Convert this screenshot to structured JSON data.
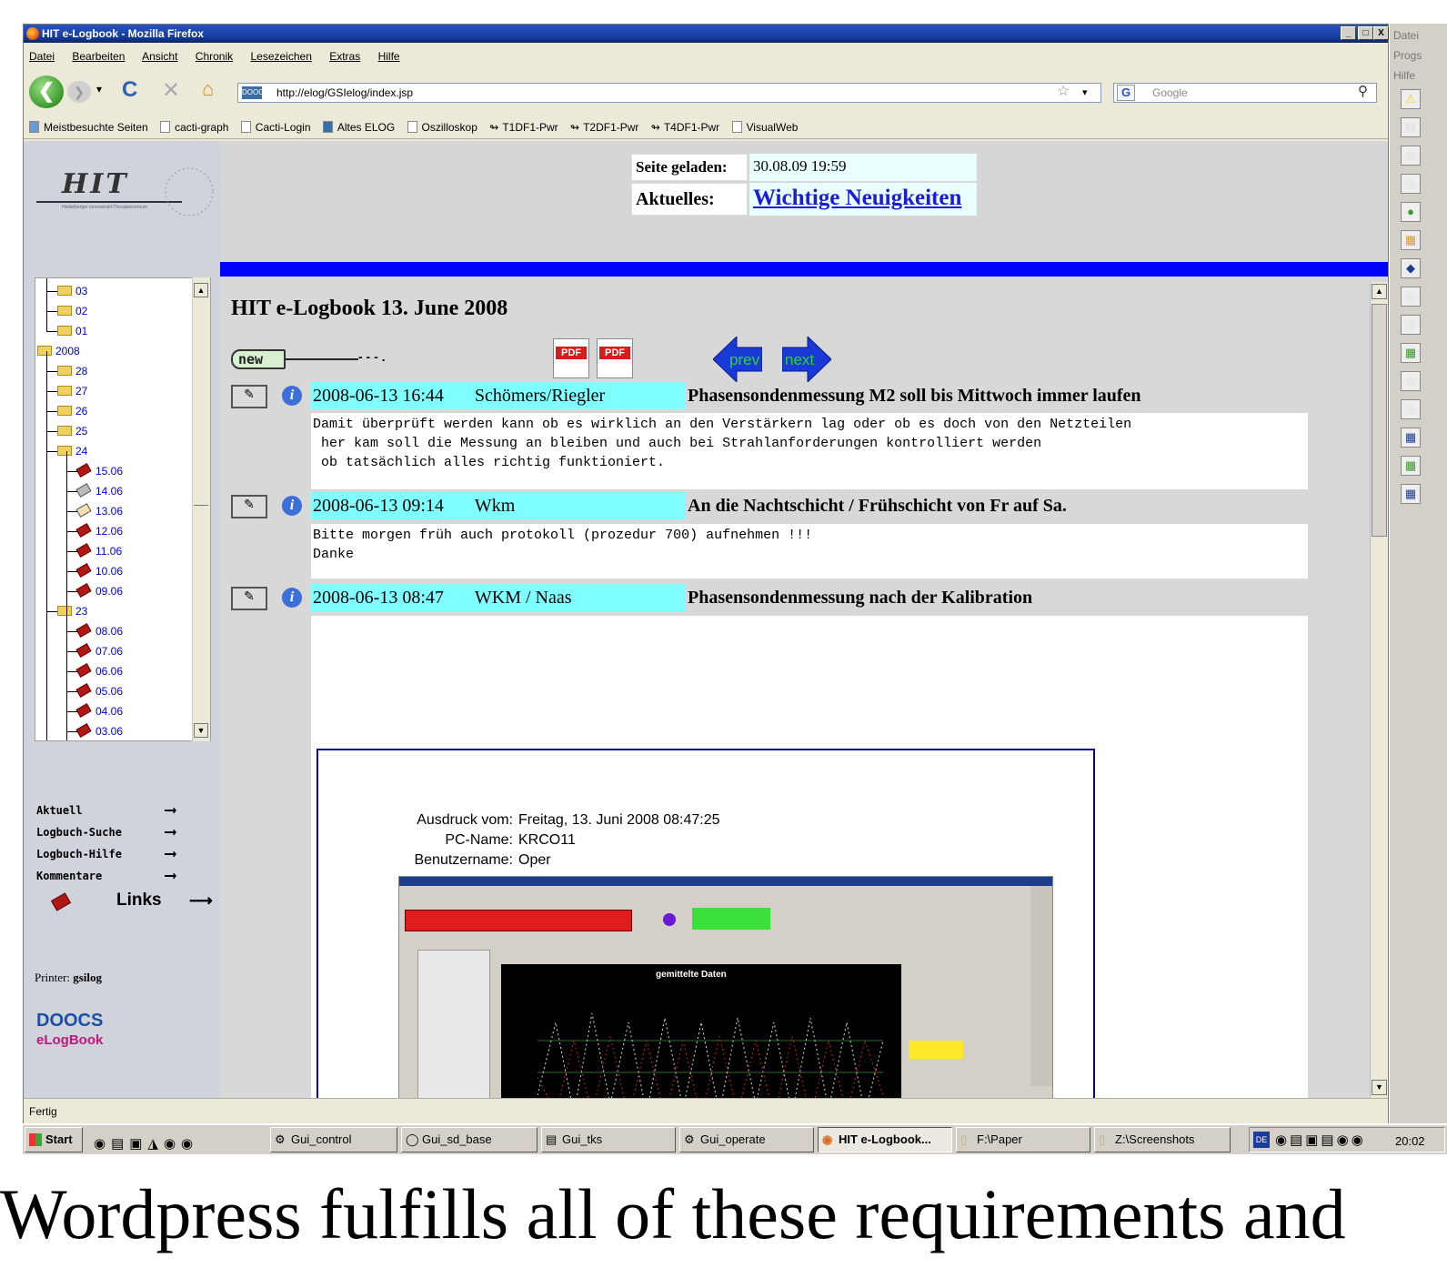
{
  "window": {
    "title": "HIT e-Logbook - Mozilla Firefox",
    "btn_min": "_",
    "btn_max": "□",
    "btn_close": "X"
  },
  "menu": [
    "Datei",
    "Bearbeiten",
    "Ansicht",
    "Chronik",
    "Lesezeichen",
    "Extras",
    "Hilfe"
  ],
  "nav": {
    "url": "http://elog/GSIelog/index.jsp",
    "search_placeholder": "Google",
    "favicon_text": "DOOCS"
  },
  "bookmarks": [
    "Meistbesuchte Seiten",
    "cacti-graph",
    "Cacti-Login",
    "Altes ELOG",
    "Oszilloskop",
    "T1DF1-Pwr",
    "T2DF1-Pwr",
    "T4DF1-Pwr",
    "VisualWeb"
  ],
  "logo": {
    "text": "HIT",
    "subtext": "Heidelberger Ionenstrahl-Therapiezentrum"
  },
  "header": {
    "loaded_label": "Seite geladen:",
    "loaded_value": "30.08.09 19:59",
    "news_label": "Aktuelles:",
    "news_link": "Wichtige Neuigkeiten"
  },
  "tree": [
    {
      "label": "03",
      "type": "folder",
      "level": 1
    },
    {
      "label": "02",
      "type": "folder",
      "level": 1
    },
    {
      "label": "01",
      "type": "folder",
      "level": 1
    },
    {
      "label": "2008",
      "type": "folder-open",
      "level": 0
    },
    {
      "label": "28",
      "type": "folder",
      "level": 1
    },
    {
      "label": "27",
      "type": "folder",
      "level": 1
    },
    {
      "label": "26",
      "type": "folder",
      "level": 1
    },
    {
      "label": "25",
      "type": "folder",
      "level": 1
    },
    {
      "label": "24",
      "type": "folder-open",
      "level": 1
    },
    {
      "label": "15.06",
      "type": "book",
      "level": 2
    },
    {
      "label": "14.06",
      "type": "book-grey",
      "level": 2
    },
    {
      "label": "13.06",
      "type": "book-open",
      "level": 2
    },
    {
      "label": "12.06",
      "type": "book",
      "level": 2
    },
    {
      "label": "11.06",
      "type": "book",
      "level": 2
    },
    {
      "label": "10.06",
      "type": "book",
      "level": 2
    },
    {
      "label": "09.06",
      "type": "book",
      "level": 2
    },
    {
      "label": "23",
      "type": "folder-open",
      "level": 1
    },
    {
      "label": "08.06",
      "type": "book",
      "level": 2
    },
    {
      "label": "07.06",
      "type": "book",
      "level": 2
    },
    {
      "label": "06.06",
      "type": "book",
      "level": 2
    },
    {
      "label": "05.06",
      "type": "book",
      "level": 2
    },
    {
      "label": "04.06",
      "type": "book",
      "level": 2
    },
    {
      "label": "03.06",
      "type": "book",
      "level": 2
    }
  ],
  "sidelinks": [
    "Aktuell",
    "Logbuch-Suche",
    "Logbuch-Hilfe",
    "Kommentare",
    "Links"
  ],
  "printer": {
    "label": "Printer:",
    "value": "gsilog"
  },
  "doocs": {
    "line1": "DOOCS",
    "line2": "eLogBook"
  },
  "page_title": "HIT e-Logbook 13. June 2008",
  "toolbar": {
    "new_label": "new",
    "pdf1": "PDF",
    "pdf2": "PDF",
    "prev": "prev",
    "next": "next"
  },
  "entries": [
    {
      "datetime": "2008-06-13 16:44",
      "author": "Schömers/Riegler",
      "subject": "Phasensondenmessung M2 soll bis Mittwoch immer laufen",
      "body": "Damit überprüft werden kann ob es wirklich an den Verstärkern lag oder ob es doch von den Netzteilen\n her kam soll die Messung an bleiben und auch bei Strahlanforderungen kontrolliert werden\n ob tatsächlich alles richtig funktioniert."
    },
    {
      "datetime": "2008-06-13 09:14",
      "author": "Wkm",
      "subject": "An die Nachtschicht / Frühschicht von Fr auf Sa.",
      "body": "Bitte morgen früh auch protokoll (prozedur 700) aufnehmen !!!\nDanke"
    },
    {
      "datetime": "2008-06-13 08:47",
      "author": "WKM / Naas",
      "subject": "Phasensondenmessung nach der Kalibration",
      "body": ""
    }
  ],
  "attachment": {
    "printed_label": "Ausdruck vom:",
    "printed_value": "Freitag, 13. Juni 2008 08:47:25",
    "pc_label": "PC-Name:",
    "pc_value": "KRCO11",
    "user_label": "Benutzername:",
    "user_value": "Oper",
    "plot_title": "gemittelte Daten"
  },
  "status": "Fertig",
  "taskbar": {
    "start": "Start",
    "items": [
      "Gui_control",
      "Gui_sd_base",
      "Gui_tks",
      "Gui_operate",
      "HIT e-Logbook...",
      "F:\\Paper",
      "Z:\\Screenshots"
    ],
    "clock": "20:02",
    "lang": "DE"
  },
  "right_panel": [
    "Datei",
    "Progs",
    "Hilfe"
  ],
  "caption": "Wordpress fulfills all of these requirements and"
}
